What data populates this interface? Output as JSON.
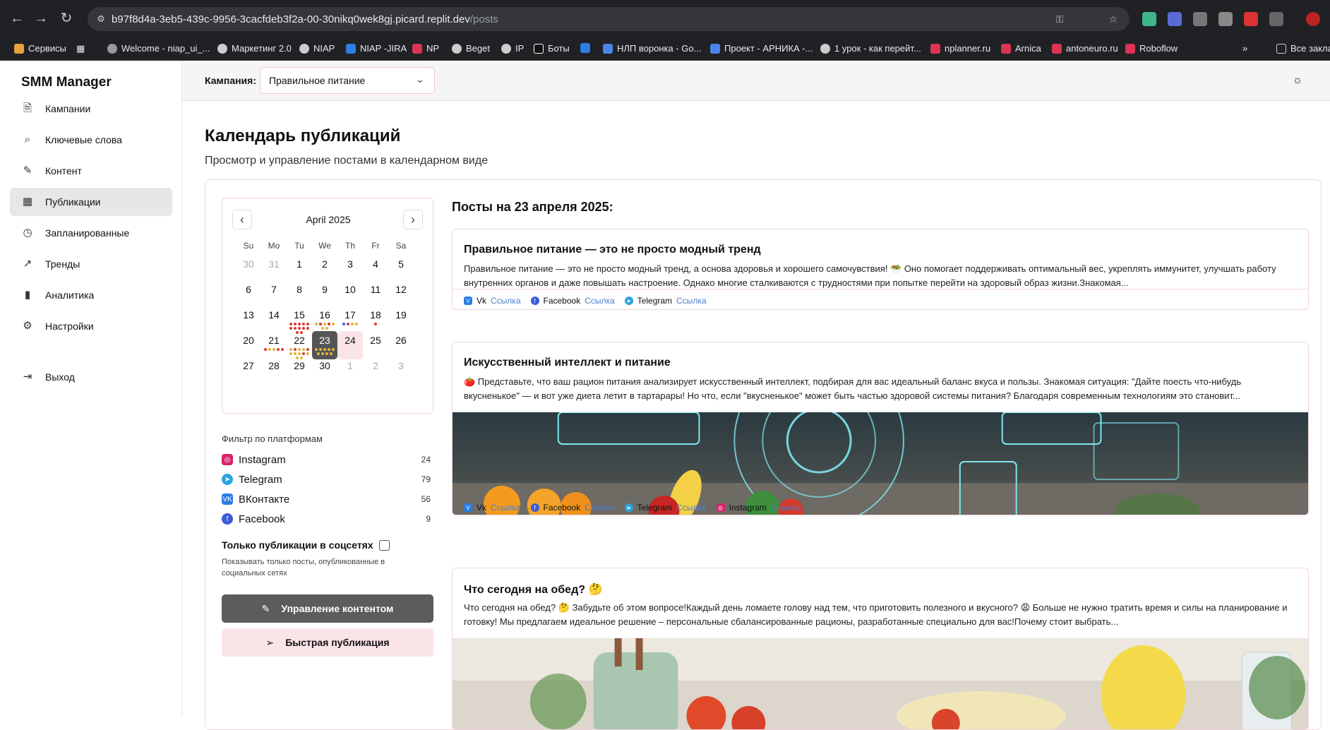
{
  "browser": {
    "url_host": "b97f8d4a-3eb5-439c-9956-3cacfdeb3f2a-00-30nikq0wek8gj.picard.replit.dev",
    "url_path": "/posts",
    "bookmarks": [
      "Сервисы",
      "Welcome - niap_ui_...",
      "Маркетинг 2.0",
      "NIAP",
      "NIAP -JIRA",
      "NP",
      "Beget",
      "IP",
      "Боты",
      "НЛП воронка - Go...",
      "Проект - АРНИКА -...",
      "1 урок - как перейт...",
      "nplanner.ru",
      "Arnica",
      "antoneuro.ru",
      "Roboflow",
      "Все закладки"
    ]
  },
  "app": {
    "brand": "SMM Manager",
    "nav": [
      {
        "label": "Кампании",
        "icon": "document-icon"
      },
      {
        "label": "Ключевые слова",
        "icon": "search-icon"
      },
      {
        "label": "Контент",
        "icon": "pen-icon"
      },
      {
        "label": "Публикации",
        "icon": "calendar-icon"
      },
      {
        "label": "Запланированные",
        "icon": "clock-icon"
      },
      {
        "label": "Тренды",
        "icon": "trend-icon"
      },
      {
        "label": "Аналитика",
        "icon": "bar-chart-icon"
      },
      {
        "label": "Настройки",
        "icon": "gear-icon"
      }
    ],
    "logout": "Выход"
  },
  "topbar": {
    "campaign_label": "Кампания:",
    "campaign_value": "Правильное питание"
  },
  "page": {
    "title": "Календарь публикаций",
    "subtitle": "Просмотр и управление постами в календарном виде"
  },
  "calendar": {
    "month": "April 2025",
    "weekdays": [
      "Su",
      "Mo",
      "Tu",
      "We",
      "Th",
      "Fr",
      "Sa"
    ],
    "weeks": [
      [
        "30",
        "31",
        "1",
        "2",
        "3",
        "4",
        "5"
      ],
      [
        "6",
        "7",
        "8",
        "9",
        "10",
        "11",
        "12"
      ],
      [
        "13",
        "14",
        "15",
        "16",
        "17",
        "18",
        "19"
      ],
      [
        "20",
        "21",
        "22",
        "23",
        "24",
        "25",
        "26"
      ],
      [
        "27",
        "28",
        "29",
        "30",
        "1",
        "2",
        "3"
      ]
    ],
    "selected": "23",
    "today": "24"
  },
  "filters": {
    "title": "Фильтр по платформам",
    "platforms": [
      {
        "name": "Instagram",
        "count": "24",
        "color": "#d6246e"
      },
      {
        "name": "Telegram",
        "count": "79",
        "color": "#2aa3e0"
      },
      {
        "name": "ВКонтакте",
        "count": "56",
        "color": "#2c7be5"
      },
      {
        "name": "Facebook",
        "count": "9",
        "color": "#3b5bd9"
      }
    ],
    "only_published_label": "Только публикации в соцсетях",
    "only_published_hint": "Показывать только посты, опубликованные в социальных сетях"
  },
  "actions": {
    "manage": "Управление контентом",
    "quick": "Быстрая публикация"
  },
  "posts": {
    "heading": "Посты на 23 апреля 2025:",
    "items": [
      {
        "title": "Правильное питание — это не просто модный тренд",
        "body": "Правильное питание — это не просто модный тренд, а основа здоровья и хорошего самочувствия! 🥗 Оно помогает поддерживать оптимальный вес, укреплять иммунитет, улучшать работу внутренних органов и даже повышать настроение. Однако многие сталкиваются с трудностями при попытке перейти на здоровый образ жизни.Знакомая...",
        "links": [
          {
            "platform": "Vk",
            "link": "Ссылка"
          },
          {
            "platform": "Facebook",
            "link": "Ссылка"
          },
          {
            "platform": "Telegram",
            "link": "Ссылка"
          }
        ]
      },
      {
        "title": "Искусственный интеллект и питание",
        "body": "🍅 Представьте, что ваш рацион питания анализирует искусственный интеллект, подбирая для вас идеальный баланс вкуса и пользы. Знакомая ситуация: \"Дайте поесть что-нибудь вкусненькое\" — и вот уже диета летит в тартарары! Но что, если \"вкусненькое\" может быть частью здоровой системы питания? Благодаря современным технологиям это становит...",
        "links": [
          {
            "platform": "Vk",
            "link": "Ссылка"
          },
          {
            "platform": "Facebook",
            "link": "Ссылка"
          },
          {
            "platform": "Telegram",
            "link": "Ссылка"
          },
          {
            "platform": "Instagram",
            "link": "Ссылка"
          }
        ]
      },
      {
        "title": "Что сегодня на обед? 🤔",
        "body": "Что сегодня на обед? 🤔 Забудьте об этом вопросе!Каждый день ломаете голову над тем, что приготовить полезного и вкусного? 😩 Больше не нужно тратить время и силы на планирование и готовку! Мы предлагаем идеальное решение – персональные сбалансированные рационы, разработанные специально для вас!Почему стоит выбрать..."
      }
    ]
  }
}
